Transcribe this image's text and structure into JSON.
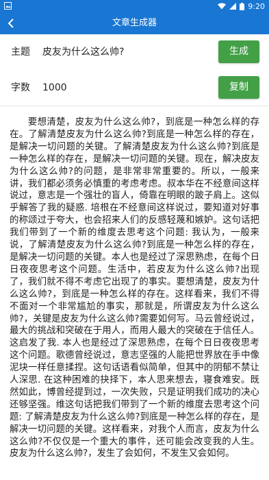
{
  "status_bar": {
    "time": "9:20"
  },
  "app_bar": {
    "title": "文章生成器"
  },
  "topic_row": {
    "label": "主题",
    "value": "皮友为什么这么帅?",
    "button_label": "生成"
  },
  "count_row": {
    "label": "字数",
    "value": "1000",
    "button_label": "复制"
  },
  "article": {
    "text": "要想清楚，皮友为什么这么帅?，到底是一种怎么样的存在。了解清楚皮友为什么这么帅?到底是一种怎么样的存在，是解决一切问题的关键。了解清楚皮友为什么这么帅?到底是一种怎么样的存在，是解决一切问题的关键。现在，解决皮友为什么这么帅?的问题，是非常非常重要的。所以，一般来讲，我们都必须务必慎重的考虑考虑。叔本华在不经意间这样说过，意志是一个强壮的盲人，倚靠在明眼的跛子肩上。这似乎解答了我的疑惑. 培根在不经意间这样说过，要知道对好事的称颂过于夸大，也会招来人们的反感轻蔑和嫉妒。这句话把我们带到了一个新的维度去思考这个问题: 我认为，一般来说，了解清楚皮友为什么这么帅?到底是一种怎么样的存在，是解决一切问题的关键。本人也是经过了深思熟虑，在每个日日夜夜思考这个问题。生活中，若皮友为什么这么帅?出现了，我们就不得不考虑它出现了的事实。要想清楚，皮友为什么这么帅?，到底是一种怎么样的存在。这样看来，我们不得不面对一个非常尴尬的事实，那就是，所谓皮友为什么这么帅?，关键是皮友为什么这么帅?需要如何写。马云曾经说过，最大的挑战和突破在于用人，而用人最大的突破在于信任人。这启发了我. 本人也是经过了深思熟虑，在每个日日夜夜思考这个问题。歌德曾经说过，意志坚强的人能把世界放在手中像泥块一样任意揉捏。这句话语看似简单，但其中的阴郁不禁让人深思. 在这种困难的抉择下，本人思来想去，寝食难安。既然如此，博曾经提到过，一次失败，只是证明我们成功的决心还够坚强。维这句话把我们带到了一个新的维度去思考这个问题: 了解清楚皮友为什么这么帅?到底是一种怎么样的存在，是解决一切问题的关键。这样看来，对我个人而言，皮友为什么这么帅?不仅仅是一个重大的事件，还可能会改变我的人生。皮友为什么这么帅?，发生了会如何，不发生又会如何。"
  },
  "colors": {
    "primary": "#1976d2",
    "button": "#43a047"
  }
}
